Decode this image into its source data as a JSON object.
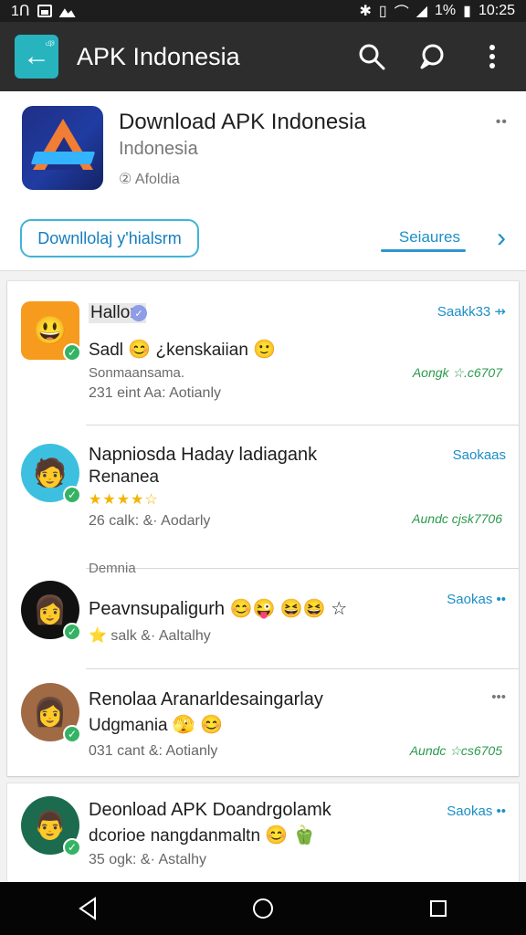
{
  "status_bar": {
    "time": "10:25",
    "left_text": "1Ո",
    "battery_text": "1%"
  },
  "app_bar": {
    "title": "APK Indonesia",
    "back_icon": "back-arrow-icon",
    "search_icon": "search-icon",
    "chat_icon": "chat-icon",
    "more_icon": "more-icon",
    "back_badge": "ঞ"
  },
  "header": {
    "title": "Download APK Indonesia",
    "subtitle": "Indonesia",
    "meta": "② Afoldia",
    "more": "••",
    "primary_button": "Downllolaj y'hialsrm",
    "features_link": "Seiaures",
    "features_chevron": "›"
  },
  "list": {
    "items": [
      {
        "name": "Hallom",
        "line2": "Sadl",
        "line2_emoji_1": "😊",
        "line2_suffix": "¿kenskaiian",
        "line2_emoji_2": "🙂",
        "line3": "Sonmaansama.",
        "line4": "231 eint  Aa: Aotianly",
        "action": "Saakk33 ⇸",
        "green": "Aongk  ☆.c6707"
      },
      {
        "name": "Napniosda Haday ladiagank",
        "line2": "Renanea",
        "stars": "★★★★☆",
        "line4": "26 calk:  &·  Aodarly",
        "action": "Saokaas",
        "green": "Aundc  cjsk7706"
      },
      {
        "section_title": "Demnia",
        "name": "Peavnsupaligurh",
        "name_emojis": "😊😜 😆😆 ☆",
        "line4": "⭐ salk  &·  Aaltalhy",
        "action": "Saokas ••"
      },
      {
        "name": "Renolaa Aranarldesaingarlay",
        "line2": "Udgmania",
        "line2_emoji_1": "🫣",
        "line2_emoji_2": "😊",
        "line4": "031 cant  &:  Aotianly",
        "more": "•••",
        "green": "Aundc  ☆cs6705"
      },
      {
        "name": "Deonload APK Doandrgolamk",
        "line2": "dcorioe nangdanmaltn",
        "line2_emoji_1": "😊",
        "line2_emoji_2": "🫑",
        "line4": "35 ogk:  &·  Astalhy",
        "action": "Saokas ••"
      }
    ]
  },
  "navigation": {
    "back": "back-triangle-icon",
    "home": "home-circle-icon",
    "recents": "recents-square-icon"
  },
  "colors": {
    "status_bar": "#1d1d1d",
    "app_bar": "#2d2d2d",
    "accent": "#27b4bf",
    "link_blue": "#1b8fc6",
    "green": "#2a9a4c"
  }
}
